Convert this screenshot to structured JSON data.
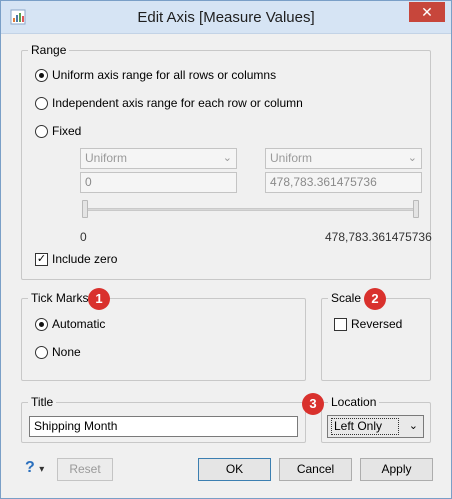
{
  "window": {
    "title": "Edit Axis [Measure Values]",
    "close_symbol": "✕"
  },
  "range": {
    "legend": "Range",
    "options": [
      {
        "label": "Uniform axis range for all rows or columns",
        "selected": true
      },
      {
        "label": "Independent axis range for each row or column",
        "selected": false
      },
      {
        "label": "Fixed",
        "selected": false
      }
    ],
    "start_mode": "Uniform",
    "end_mode": "Uniform",
    "start_value": "0",
    "end_value": "478,783.361475736",
    "slider_min_label": "0",
    "slider_max_label": "478,783.361475736",
    "include_zero_label": "Include zero",
    "include_zero_checked": true,
    "check_symbol": "✓",
    "dropdown_symbol": "⌄"
  },
  "tick_marks": {
    "legend": "Tick Marks",
    "options": [
      {
        "label": "Automatic",
        "selected": true
      },
      {
        "label": "None",
        "selected": false
      }
    ],
    "badge": "1"
  },
  "scale": {
    "legend": "Scale",
    "reversed_label": "Reversed",
    "reversed_checked": false,
    "badge": "2"
  },
  "title_group": {
    "legend": "Title",
    "value": "Shipping Month"
  },
  "location": {
    "legend": "Location",
    "value": "Left Only",
    "badge": "3",
    "dropdown_symbol": "⌄"
  },
  "footer": {
    "help_symbol": "?",
    "help_caret": "▾",
    "reset_label": "Reset",
    "ok_label": "OK",
    "cancel_label": "Cancel",
    "apply_label": "Apply"
  },
  "colors": {
    "badge": "#d9312d",
    "titlebar": "#d6e4f4",
    "close": "#c7463b",
    "help": "#2a6fbd"
  }
}
